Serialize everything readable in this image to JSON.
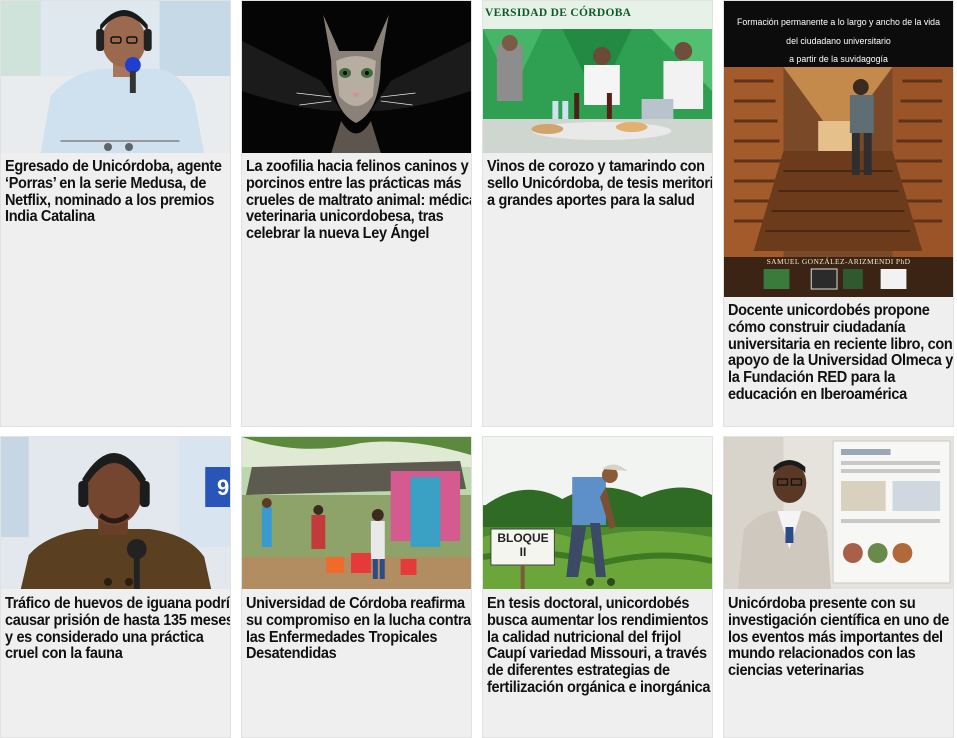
{
  "articles": [
    {
      "headline": "Egresado de Unicórdoba, agente ‘Porras’ en la serie Medusa, de Netflix, nominado a los premios India Catalina",
      "image": "radio-interview-photo"
    },
    {
      "headline": "La zoofilia hacia felinos caninos y porcinos entre las prácticas más crueles de maltrato animal: médica veterinaria unicordobesa, tras celebrar la nueva Ley Ángel",
      "image": "cat-photo"
    },
    {
      "headline": "Vinos de corozo y tamarindo con sello Unicórdoba, de tesis meritoria a grandes aportes para la salud",
      "image": "wine-presentation-photo",
      "banner_text": "VERSIDAD DE CÓRDOBA"
    },
    {
      "headline": "Docente unicordobés propone cómo construir ciudadanía universitaria en reciente libro, con apoyo de la Universidad Olmeca y la Fundación RED para la educación en Iberoamérica",
      "image": "book-cover",
      "book_title_lines": [
        "Formación permanente a lo largo y ancho de la vida",
        "del ciudadano universitario",
        "a partir de la suvidagogía"
      ],
      "book_author": "SAMUEL GONZÁLEZ-ARIZMENDI  PhD"
    },
    {
      "headline": "Tráfico de huevos de iguana podría causar prisión de hasta 135 meses y es considerado una práctica cruel con la fauna",
      "image": "radio-interview-photo-2",
      "studio_text": "9"
    },
    {
      "headline": "Universidad de Córdoba reafirma su compromiso en la lucha contra las Enfermedades Tropicales Desatendidas",
      "image": "outdoor-health-event-photo"
    },
    {
      "headline": "En tesis doctoral, unicordobés busca aumentar los rendimientos y la calidad nutricional del frijol Caupí variedad Missouri, a través de diferentes estrategias de fertilización orgánica e inorgánica",
      "image": "bean-field-photo",
      "sign_lines": [
        "BLOQUE",
        "II"
      ]
    },
    {
      "headline": "Unicórdoba presente con su investigación científica en uno de los eventos más importantes del mundo relacionados con las ciencias veterinarias",
      "image": "researcher-poster-photo"
    }
  ],
  "colors": {
    "card_bg": "#efefef",
    "headline": "#111111",
    "page_bg": "#ffffff"
  }
}
